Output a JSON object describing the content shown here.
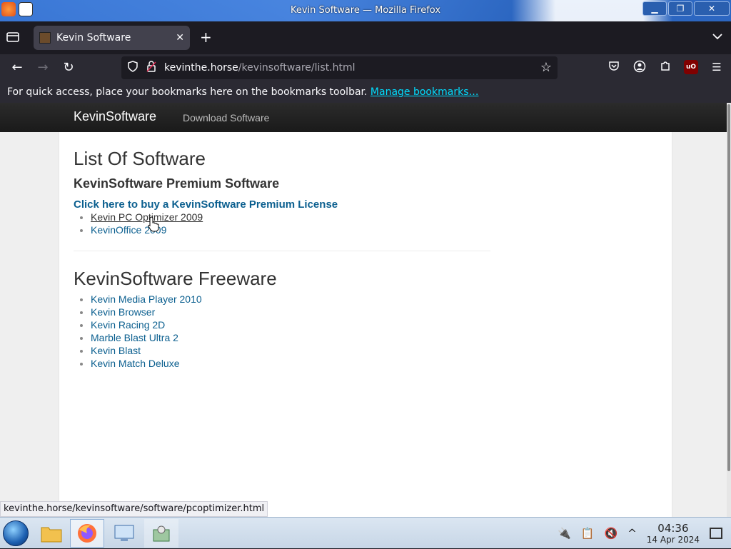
{
  "window": {
    "title": "Kevin Software — Mozilla Firefox"
  },
  "tabs": [
    {
      "label": "Kevin Software",
      "active": true
    }
  ],
  "urlbar": {
    "domain": "kevinthe.horse",
    "path": "/kevinsoftware/list.html"
  },
  "bookmarks_bar": {
    "message": "For quick access, place your bookmarks here on the bookmarks toolbar.",
    "link": "Manage bookmarks…"
  },
  "site": {
    "brand": "KevinSoftware",
    "nav_link": "Download Software"
  },
  "page": {
    "heading": "List Of Software",
    "premium_heading": "KevinSoftware Premium Software",
    "buy_link": "Click here to buy a KevinSoftware Premium License",
    "premium_items": [
      "Kevin PC Optimizer 2009",
      "KevinOffice 2009"
    ],
    "freeware_heading": "KevinSoftware Freeware",
    "freeware_items": [
      "Kevin Media Player 2010",
      "Kevin Browser",
      "Kevin Racing 2D",
      "Marble Blast Ultra 2",
      "Kevin Blast",
      "Kevin Match Deluxe"
    ]
  },
  "status_url": "kevinthe.horse/kevinsoftware/software/pcoptimizer.html",
  "taskbar": {
    "time": "04:36",
    "date": "14 Apr 2024"
  },
  "colors": {
    "link": "#0b5f8f",
    "firefox_chrome": "#2b2a33",
    "accent_link": "#00ddff"
  }
}
